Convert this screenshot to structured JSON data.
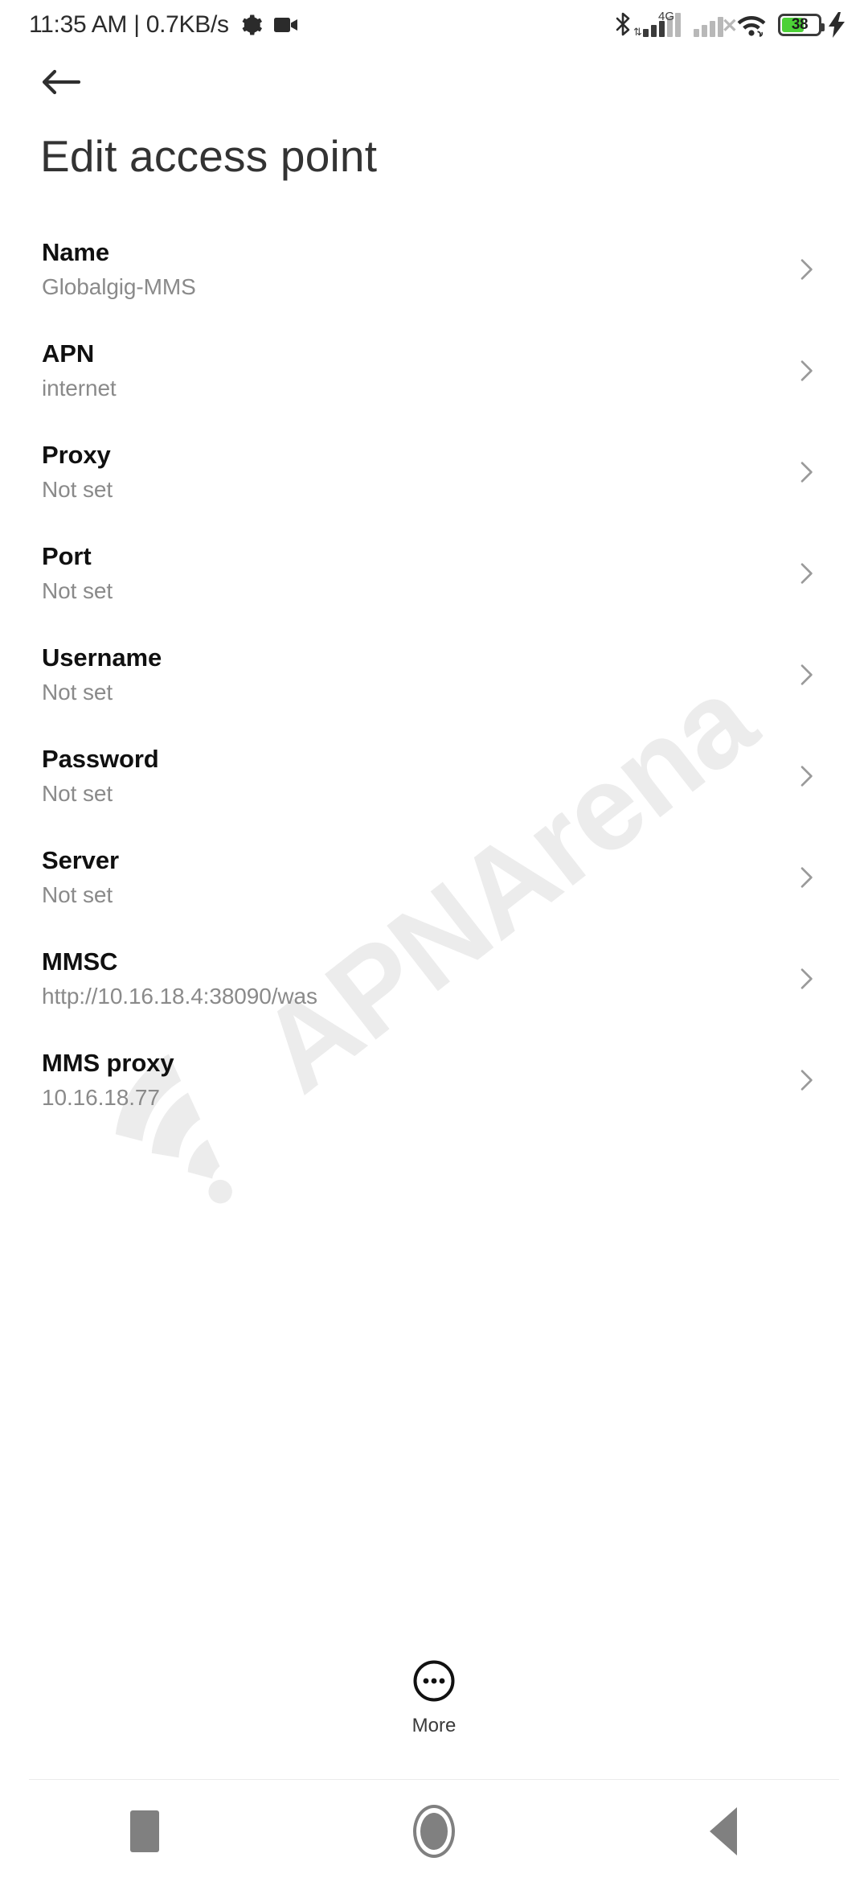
{
  "statusbar": {
    "time": "11:35 AM",
    "separator": "|",
    "network_speed": "0.7KB/s",
    "gear_icon": "gear-icon",
    "camera_icon": "screen-recorder-icon",
    "bluetooth_icon": "bluetooth-icon",
    "sim1_network_label": "4G",
    "sim1_icon": "signal-bars-sim1-icon",
    "sim2_icon": "signal-bars-sim2-no-service-icon",
    "wifi_icon": "wifi-connected-icon",
    "battery_icon": "battery-icon",
    "battery_percent": "38",
    "charging_icon": "charging-bolt-icon"
  },
  "appbar": {
    "back_icon": "back-arrow-icon",
    "title": "Edit access point"
  },
  "watermark": {
    "text": "APNArena",
    "logo_icon": "wifi-arc-logo-icon"
  },
  "list": {
    "chevron_icon": "chevron-right-icon",
    "items": [
      {
        "label": "Name",
        "value": "Globalgig-MMS"
      },
      {
        "label": "APN",
        "value": "internet"
      },
      {
        "label": "Proxy",
        "value": "Not set"
      },
      {
        "label": "Port",
        "value": "Not set"
      },
      {
        "label": "Username",
        "value": "Not set"
      },
      {
        "label": "Password",
        "value": "Not set"
      },
      {
        "label": "Server",
        "value": "Not set"
      },
      {
        "label": "MMSC",
        "value": "http://10.16.18.4:38090/was"
      },
      {
        "label": "MMS proxy",
        "value": "10.16.18.77"
      }
    ]
  },
  "more_button": {
    "label": "More",
    "icon": "more-circle-icon"
  },
  "navbar": {
    "recents_icon": "recents-square-icon",
    "home_icon": "home-circle-icon",
    "back_icon": "back-triangle-icon"
  }
}
